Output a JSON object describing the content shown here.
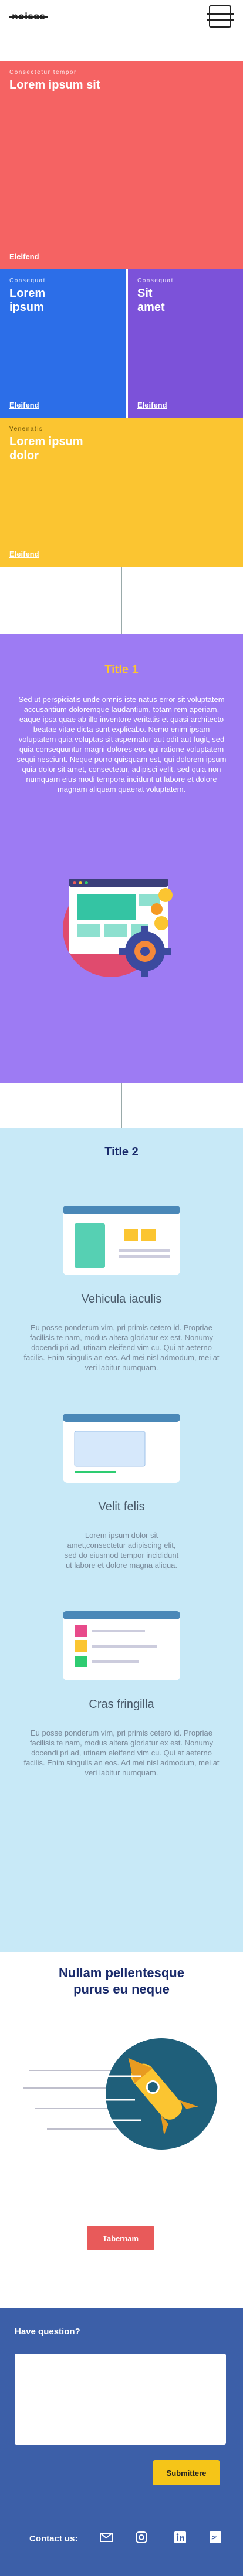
{
  "header": {
    "logo": "noises",
    "menu_icon": "hamburger-menu-icon"
  },
  "tiles": [
    {
      "eyebrow": "Consectetur tempor",
      "title": "Lorem ipsum sit",
      "link": "Eleifend",
      "color": "#f56363"
    },
    {
      "eyebrow": "Consequat",
      "title": "Lorem ipsum",
      "link": "Eleifend",
      "color": "#2c6ee8"
    },
    {
      "eyebrow": "Consequat",
      "title": "Sit amet",
      "link": "Eleifend",
      "color": "#7c52d9"
    },
    {
      "eyebrow": "Venenatis",
      "title": "Lorem ipsum dolor",
      "link": "Eleifend",
      "color": "#fbc531"
    }
  ],
  "section1": {
    "title": "Title 1",
    "body": "Sed ut perspiciatis unde omnis iste natus error sit voluptatem accusantium doloremque laudantium, totam rem aperiam, eaque ipsa quae ab illo inventore veritatis et quasi architecto beatae vitae dicta sunt explicabo. Nemo enim ipsam voluptatem quia voluptas sit aspernatur aut odit aut fugit, sed quia consequuntur magni dolores eos qui ratione voluptatem sequi nesciunt. Neque porro quisquam est, qui dolorem ipsum quia dolor sit amet, consectetur, adipisci velit, sed quia non numquam eius modi tempora incidunt ut labore et dolore magnam aliquam quaerat voluptatem."
  },
  "section2": {
    "title": "Title 2",
    "features": [
      {
        "title": "Vehicula iaculis",
        "body": "Eu posse ponderum vim, pri primis cetero id. Propriae facilisis te nam, modus altera gloriatur ex est. Nonumy docendi pri ad, utinam eleifend vim cu. Qui at aeterno facilis. Enim singulis an eos. Ad mei nisl admodum, mei at veri labitur numquam."
      },
      {
        "title": "Velit felis",
        "body": "Lorem ipsum dolor sit amet,consectetur adipiscing elit, sed do eiusmod tempor incididunt ut labore et dolore magna aliqua."
      },
      {
        "title": "Cras fringilla",
        "body": "Eu posse ponderum vim, pri primis cetero id. Propriae facilisis te nam, modus altera gloriatur ex est. Nonumy docendi pri ad, utinam eleifend vim cu. Qui at aeterno facilis. Enim singulis an eos. Ad mei nisl admodum, mei at veri labitur numquam."
      }
    ]
  },
  "cta": {
    "title": "Nullam pellentesque purus eu neque",
    "button": "Tabernam"
  },
  "footer": {
    "question": "Have question?",
    "submit": "Submittere",
    "contact": "Contact us:",
    "icons": [
      "email-icon",
      "instagram-icon",
      "linkedin-icon",
      "twitter-icon"
    ]
  }
}
